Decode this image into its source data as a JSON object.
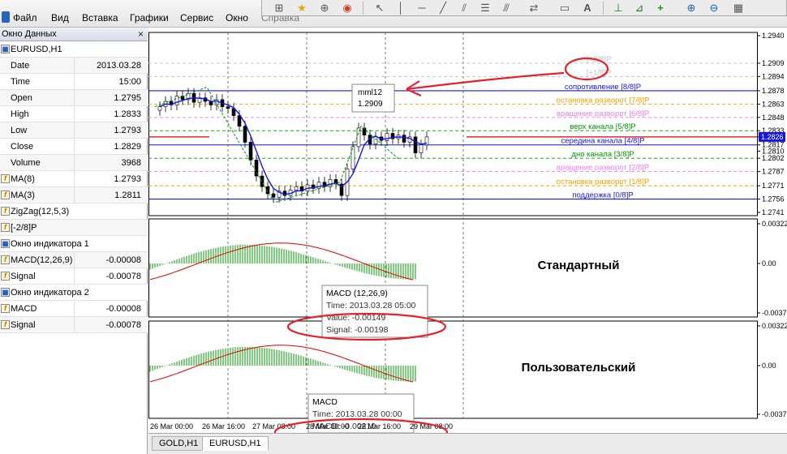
{
  "menu": [
    "Файл",
    "Вид",
    "Вставка",
    "Графики",
    "Сервис",
    "Окно",
    "Справка"
  ],
  "data_window": {
    "title": "Окно Данных",
    "rows": [
      {
        "kind": "header",
        "icon": "chart-window-icon",
        "label": "EURUSD,H1",
        "value": ""
      },
      {
        "kind": "row",
        "icon": "",
        "label": "Date",
        "value": "2013.03.28"
      },
      {
        "kind": "row",
        "icon": "",
        "label": "Time",
        "value": "15:00"
      },
      {
        "kind": "row",
        "icon": "",
        "label": "Open",
        "value": "1.2795"
      },
      {
        "kind": "row",
        "icon": "",
        "label": "High",
        "value": "1.2833"
      },
      {
        "kind": "row",
        "icon": "",
        "label": "Low",
        "value": "1.2793"
      },
      {
        "kind": "row",
        "icon": "",
        "label": "Close",
        "value": "1.2829"
      },
      {
        "kind": "row",
        "icon": "",
        "label": "Volume",
        "value": "3968"
      },
      {
        "kind": "row",
        "icon": "indicator-icon",
        "label": "MA(8)",
        "value": "1.2793"
      },
      {
        "kind": "row",
        "icon": "indicator-icon",
        "label": "MA(3)",
        "value": "1.2811"
      },
      {
        "kind": "row",
        "icon": "indicator-icon",
        "label": "ZigZag(12,5,3)",
        "value": ""
      },
      {
        "kind": "row",
        "icon": "indicator-icon",
        "label": "[-2/8]P",
        "value": ""
      },
      {
        "kind": "header",
        "icon": "indicator-window-icon",
        "label": "Окно индикатора 1",
        "value": ""
      },
      {
        "kind": "row",
        "icon": "indicator-icon",
        "label": "MACD(12,26,9)",
        "value": "-0.00008"
      },
      {
        "kind": "row",
        "icon": "indicator-icon",
        "label": "Signal",
        "value": "-0.00078"
      },
      {
        "kind": "header",
        "icon": "indicator-window-icon",
        "label": "Окно индикатора 2",
        "value": ""
      },
      {
        "kind": "row",
        "icon": "indicator-icon",
        "label": "MACD",
        "value": "-0.00008"
      },
      {
        "kind": "row",
        "icon": "indicator-icon",
        "label": "Signal",
        "value": "-0.00078"
      }
    ]
  },
  "toolbar_icons": [
    "new-order-icon",
    "favorites-icon",
    "crosshair-icon",
    "expert-icon",
    "cursor-icon",
    "vertical-line-icon",
    "horizontal-line-icon",
    "trendline-icon",
    "channel-icon",
    "fibonacci-icon",
    "fibonacci-fan-icon",
    "arrows-icon",
    "rectangle-icon",
    "text-icon",
    "timeframes-icon",
    "indicators-icon",
    "add-indicator-icon",
    "zoom-in-icon",
    "zoom-out-icon",
    "tile-windows-icon"
  ],
  "toolbar_text_label": "A",
  "chart": {
    "price_scale": [
      "1.2940",
      "1.2909",
      "1.2894",
      "1.2878",
      "1.2863",
      "1.2848",
      "1.2833",
      "1.2826",
      "1.2817",
      "1.2810",
      "1.2802",
      "1.2787",
      "1.2771",
      "1.2756",
      "1.2741"
    ],
    "murrey_levels": [
      {
        "label": "[+2/8]P",
        "price": "1.2909",
        "color": "#c0c0c0"
      },
      {
        "label": "[+1/8]P",
        "price": "1.2894",
        "color": "#c0c0c0"
      },
      {
        "label": "сопротивление [8/8]P",
        "price": "1.2878",
        "color": "#1414e6"
      },
      {
        "label": "остановка разворот [7/8]P",
        "price": "1.2863",
        "color": "#f0a000"
      },
      {
        "label": "вращение разворот [6/8]P",
        "price": "1.2848",
        "color": "#f07cf0"
      },
      {
        "label": "верх канала [5/8]P",
        "price": "1.2833",
        "color": "#009900"
      },
      {
        "label": "середина канала [4/8]P",
        "price": "1.2817",
        "color": "#1414e6"
      },
      {
        "label": "дно канала [3/8]P",
        "price": "1.2802",
        "color": "#009900"
      },
      {
        "label": "вращение разворот [2/8]P",
        "price": "1.2787",
        "color": "#f07cf0"
      },
      {
        "label": "остановка разворот [1/8]P",
        "price": "1.2771",
        "color": "#f0a000"
      },
      {
        "label": "поддержка [0/8]P",
        "price": "1.2756",
        "color": "#1414e6"
      }
    ],
    "cursor_tooltip": {
      "title": "mml12",
      "value": "1.2909"
    },
    "current_price": "1.2826",
    "indicator1": {
      "title": "Стандартный",
      "scale": [
        "0.00322",
        "0.00",
        "-0.00377"
      ],
      "tooltip": {
        "title": "MACD (12,26,9)",
        "time": "Time: 2013.03.28 05:00",
        "value": "Value: -0.00149",
        "signal": "Signal: -0.00198"
      }
    },
    "indicator2": {
      "title": "Пользовательский",
      "scale": [
        "0.00322",
        "0.00",
        "-0.00377"
      ],
      "tooltip": {
        "title": "MACD",
        "time": "Time: 2013.03.28 00:00",
        "value": "MACD: -0.00210"
      }
    },
    "time_axis": [
      "26 Mar 00:00",
      "26 Mar 16:00",
      "27 Mar 08:00",
      "28 Mar 00:00",
      "28 Mar 16:00",
      "29 Mar 08:00"
    ]
  },
  "tabs": [
    "GOLD,H1",
    "EURUSD,H1"
  ],
  "active_tab": 1,
  "colors": {
    "annotation": "#e8202a",
    "macd_histogram": "#009900",
    "signal": "#e60000",
    "ma_fast": "#1414e6",
    "zigzag": "#009900"
  }
}
